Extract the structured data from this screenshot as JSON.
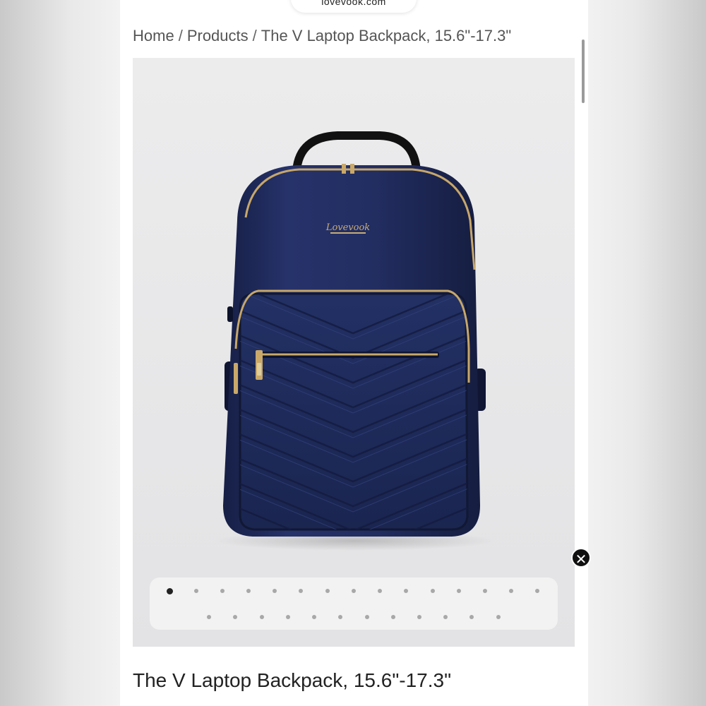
{
  "browser": {
    "url": "lovevook.com"
  },
  "breadcrumb": {
    "home": "Home",
    "separator": "/",
    "products": "Products",
    "current": "The V Laptop Backpack, 15.6\"-17.3\""
  },
  "product": {
    "title": "The V Laptop Backpack, 15.6\"-17.3\"",
    "image": {
      "icon": "navy-quilted-backpack-photo",
      "brand_mark": "Lovevook",
      "color": "#1f2a55"
    },
    "gallery": {
      "image_count": 28,
      "active_index": 0
    }
  },
  "overlay": {
    "close_symbol": "✕"
  }
}
